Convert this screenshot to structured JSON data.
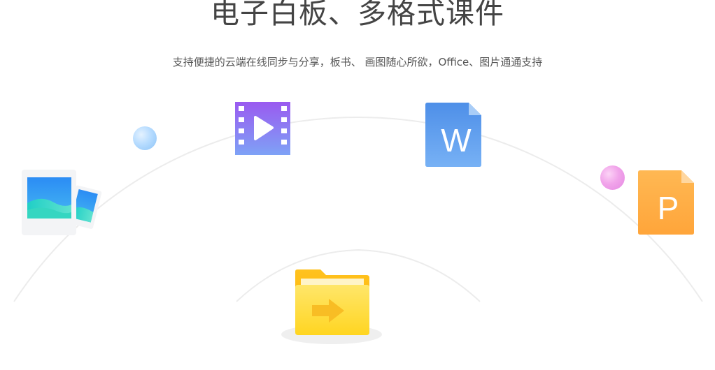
{
  "hero": {
    "title": "电子白板、多格式课件",
    "subtitle": "支持便捷的云端在线同步与分享，板书、 画图随心所欲，Office、图片通通支持"
  },
  "icons": [
    {
      "name": "image-file-icon",
      "label": ""
    },
    {
      "name": "video-file-icon",
      "label": ""
    },
    {
      "name": "word-file-icon",
      "label": "W"
    },
    {
      "name": "powerpoint-file-icon",
      "label": "P"
    },
    {
      "name": "folder-icon",
      "label": ""
    }
  ],
  "colors": {
    "title": "#444444",
    "subtitle": "#555555",
    "arc": "#ececec",
    "video": "#8b6cf2",
    "word": "#5b9bef",
    "powerpoint": "#ffad45",
    "folder": "#ffd83a"
  }
}
